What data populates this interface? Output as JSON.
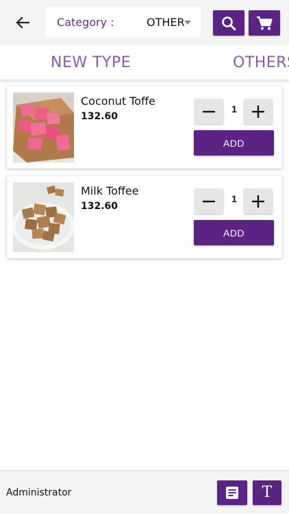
{
  "header": {
    "back_icon": "arrow-left-icon",
    "category_label": "Category :",
    "category_value": "OTHER",
    "search_icon": "search-icon",
    "cart_icon": "cart-icon",
    "accent_color": "#5b2384"
  },
  "tabs": [
    {
      "label": "NEW TYPE"
    },
    {
      "label": "OTHERS"
    }
  ],
  "products": [
    {
      "name": "Coconut Toffe",
      "price": "132.60",
      "quantity": "1",
      "add_label": "ADD",
      "image": "coconut-toffee-photo"
    },
    {
      "name": "Milk Toffee",
      "price": "132.60",
      "quantity": "1",
      "add_label": "ADD",
      "image": "milk-toffee-photo"
    }
  ],
  "footer": {
    "user": "Administrator",
    "report_icon": "report-icon",
    "text_icon": "text-format-icon"
  }
}
